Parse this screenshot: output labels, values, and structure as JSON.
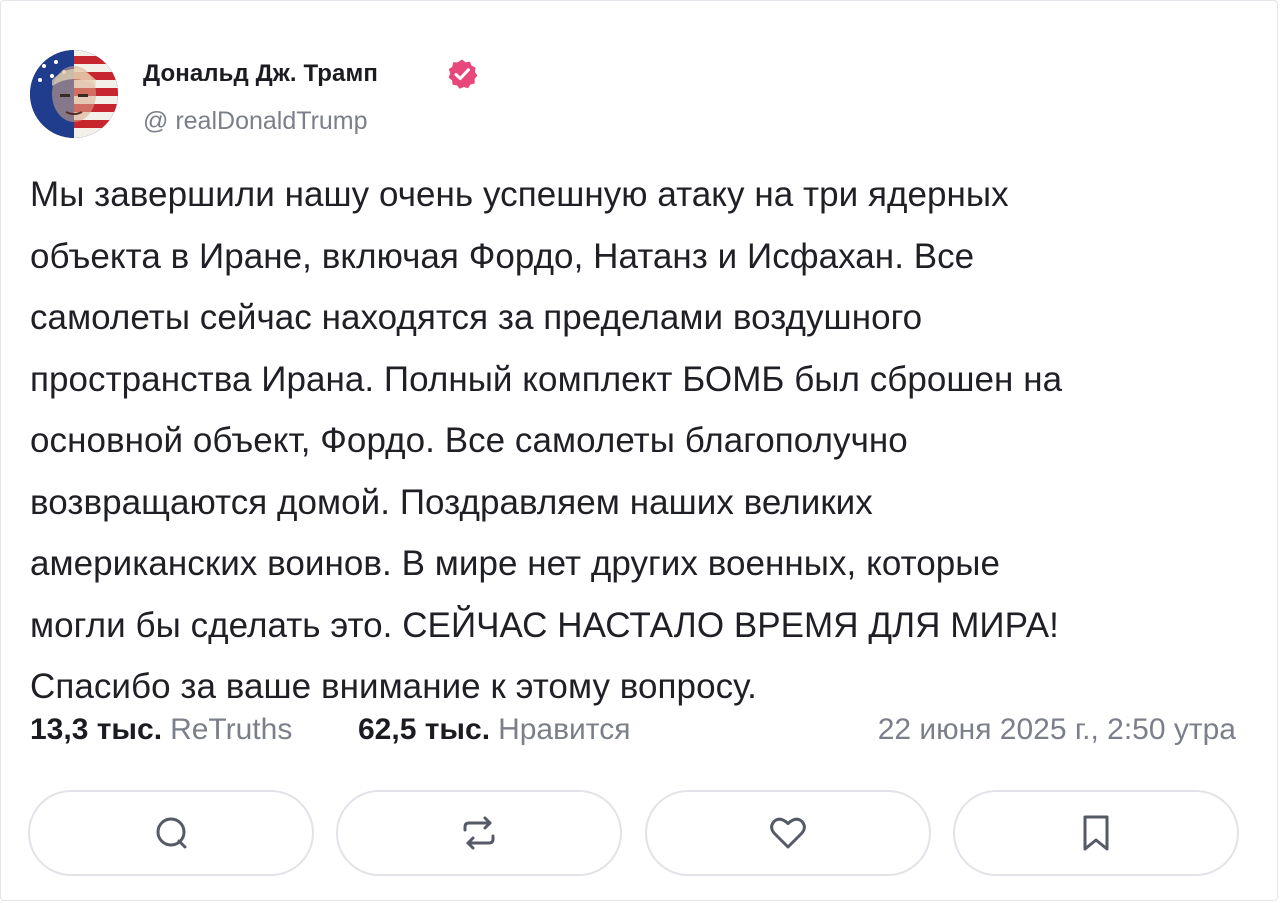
{
  "post": {
    "author": {
      "display_name": "Дональд Дж. Трамп",
      "handle": "@ realDonaldTrump",
      "verified": true,
      "verified_color": "#e8477c"
    },
    "body": "Мы завершили нашу очень успешную атаку на три ядерных\nобъекта в Иране, включая Фордо, Натанз и Исфахан. Все\nсамолеты сейчас находятся за пределами воздушного\nпространства Ирана. Полный комплект БОМБ был сброшен на\nосновной объект, Фордо. Все самолеты благополучно\nвозвращаются домой. Поздравляем наших великих\nамериканских воинов. В мире нет других военных, которые\nмогли бы сделать это. СЕЙЧАС НАСТАЛО ВРЕМЯ ДЛЯ МИРА!\nСпасибо за ваше внимание к этому вопросу.",
    "stats": {
      "retruths_count": "13,3 тыс.",
      "retruths_label": "ReTruths",
      "likes_count": "62,5 тыс.",
      "likes_label": "Нравится"
    },
    "timestamp": "22 июня 2025 г., 2:50 утра"
  },
  "actions": [
    {
      "name": "reply",
      "icon": "comment-icon"
    },
    {
      "name": "retruth",
      "icon": "retruth-icon"
    },
    {
      "name": "like",
      "icon": "heart-icon"
    },
    {
      "name": "bookmark",
      "icon": "bookmark-icon"
    }
  ],
  "colors": {
    "text": "#1b1b22",
    "muted": "#7b7f8a",
    "border": "#e2e3e8",
    "icon": "#555a66"
  }
}
